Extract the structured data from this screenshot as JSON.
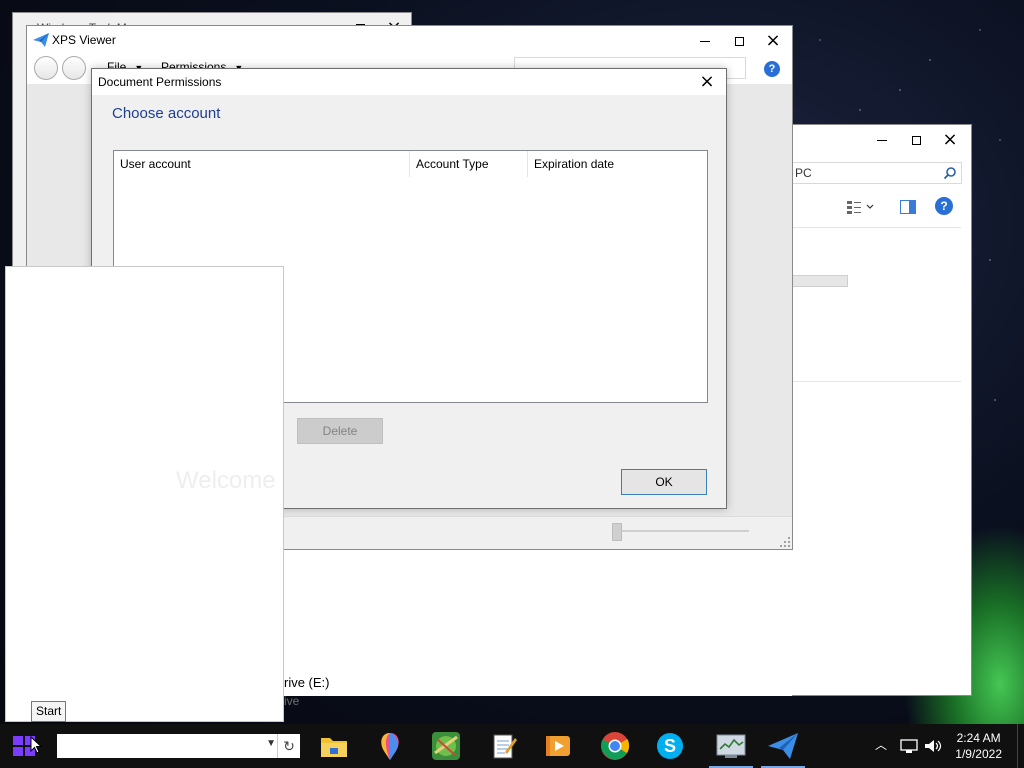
{
  "taskmgr": {
    "title": "Windows Task Manager"
  },
  "xps": {
    "title": "XPS Viewer",
    "menus": [
      "File",
      "Permissions"
    ],
    "help_label": "?"
  },
  "explorer": {
    "search_text": "PC"
  },
  "permissions_dialog": {
    "title": "Document Permissions",
    "heading": "Choose account",
    "columns": [
      "User account",
      "Account Type",
      "Expiration date"
    ],
    "delete_label": "Delete",
    "ok_label": "OK"
  },
  "start": {
    "welcome_text": "Welcome",
    "tooltip": "Start"
  },
  "drive": {
    "label": "rive (E:)",
    "sublabel": "ive"
  },
  "clock": {
    "time": "2:24 AM",
    "date": "1/9/2022"
  },
  "colors": {
    "accent": "#2a6fd6",
    "heading": "#1e3f8c",
    "taskbar": "#101010"
  }
}
